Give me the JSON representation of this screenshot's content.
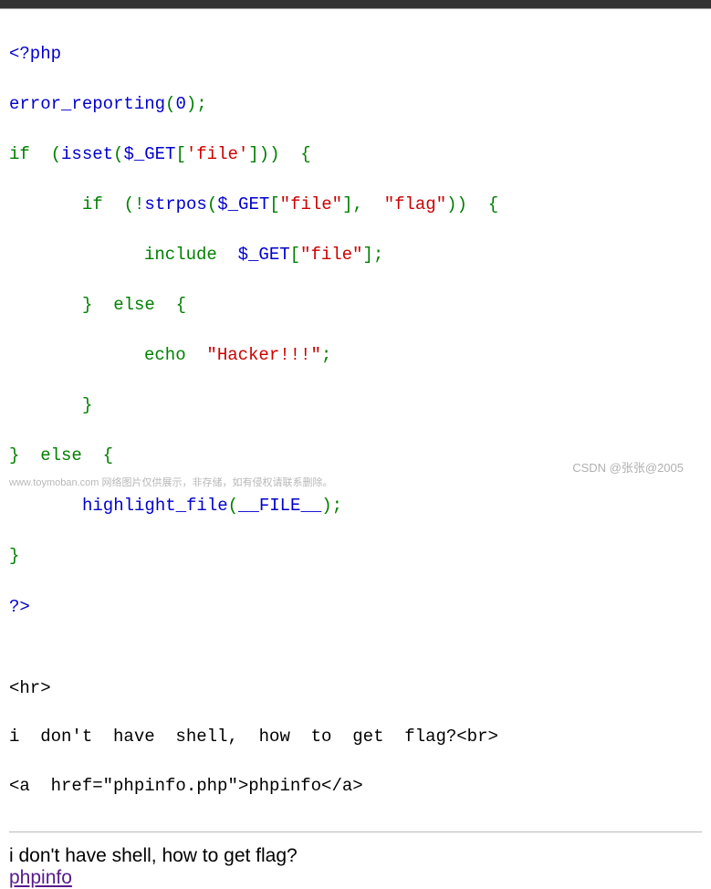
{
  "code": {
    "l1": "<?php",
    "l2a": "error_reporting",
    "l2b": "(",
    "l2c": "0",
    "l2d": ");",
    "l3a": "if  ",
    "l3b": "(",
    "l3c": "isset",
    "l3d": "(",
    "l3e": "$_GET",
    "l3f": "[",
    "l3g": "'file'",
    "l3h": "]))  {",
    "l4a": "if  ",
    "l4b": "(!",
    "l4c": "strpos",
    "l4d": "(",
    "l4e": "$_GET",
    "l4f": "[",
    "l4g": "\"file\"",
    "l4h": "],  ",
    "l4i": "\"flag\"",
    "l4j": "))  {",
    "l5a": "include  ",
    "l5b": "$_GET",
    "l5c": "[",
    "l5d": "\"file\"",
    "l5e": "];",
    "l6a": "}  ",
    "l6b": "else  ",
    "l6c": "{",
    "l7a": "echo  ",
    "l7b": "\"Hacker!!!\"",
    "l7c": ";",
    "l8": "}",
    "l9a": "}  ",
    "l9b": "else  ",
    "l9c": "{",
    "l10a": "highlight_file",
    "l10b": "(",
    "l10c": "__FILE__",
    "l10d": ");",
    "l11": "}",
    "l12": "?>"
  },
  "plain": {
    "hr": "<hr>",
    "line1": "i  don't  have  shell,  how  to  get  flag?<br>",
    "line2": "<a  href=\"phpinfo.php\">phpinfo</a>"
  },
  "rendered": {
    "text": "i don't have shell, how to get flag?",
    "link": "phpinfo"
  },
  "watermark": {
    "left": "www.toymoban.com 网络图片仅供展示，非存储，如有侵权请联系删除。",
    "right": "CSDN @张张@2005"
  }
}
